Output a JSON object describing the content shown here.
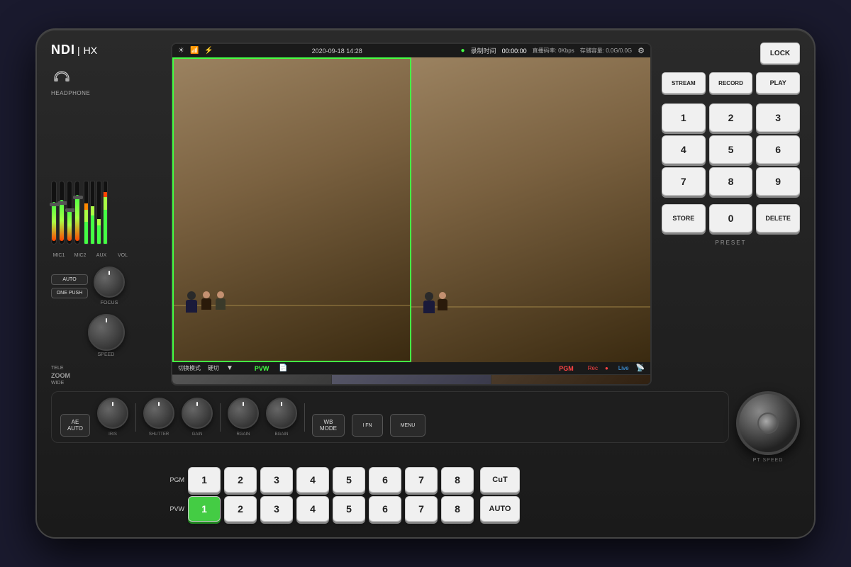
{
  "device": {
    "brand": "NDI",
    "model": "HX",
    "logo": "NDI|HX"
  },
  "left_panel": {
    "headphone_label": "HEADPHONE",
    "fader_labels": [
      "MIC1",
      "MIC2",
      "AUX",
      "VOL"
    ],
    "auto_btn": "AUTO",
    "one_push_btn": "ONE PUSH",
    "focus_label": "FOCUS",
    "speed_label": "SPEED",
    "tele_label": "TELE",
    "zoom_label": "ZOOM",
    "wide_label": "WIDE"
  },
  "screen": {
    "datetime": "2020-09-18 14:28",
    "status_label": "录制时间",
    "record_time": "00:00:00",
    "bitrate_label": "直播码率: 0Kbps",
    "storage_label": "存储容量: 0.0G/0.0G",
    "switch_mode": "切换模式",
    "cut_mode": "硬切",
    "pvw_label": "PVW",
    "pgm_label": "PGM",
    "rec_label": "Rec",
    "live_label": "Live"
  },
  "knobs_row": {
    "ae_auto_label": "AE AUTO",
    "iris_label": "IRIS",
    "shutter_label": "SHUTTER",
    "gain_label": "GAIN",
    "rgain_label": "RGAIN",
    "bgain_label": "BGAIN",
    "wb_mode_label": "WB MODE",
    "fn_label": "I FN",
    "menu_label": "MENU"
  },
  "pgm_row": {
    "label": "PGM",
    "buttons": [
      "1",
      "2",
      "3",
      "4",
      "5",
      "6",
      "7",
      "8"
    ]
  },
  "pvw_row": {
    "label": "PVW",
    "buttons": [
      "1",
      "2",
      "3",
      "4",
      "5",
      "6",
      "7",
      "8"
    ]
  },
  "cut_btn": "CuT",
  "auto_btn": "AUTO",
  "right_panel": {
    "lock_btn": "LOCK",
    "stream_btn": "STREAM",
    "record_btn": "RECORD",
    "play_btn": "PLAY",
    "numpad": [
      "1",
      "2",
      "3",
      "4",
      "5",
      "6",
      "7",
      "8",
      "9"
    ],
    "store_btn": "STORE",
    "zero_btn": "0",
    "delete_btn": "DELETE",
    "preset_label": "PRESET"
  },
  "pt_speed_label": "PT SPEED",
  "colors": {
    "active_green": "#44ff44",
    "active_red": "#ff4444",
    "button_bg": "#f0f0f0",
    "device_bg": "#222",
    "screen_border": "#44ff44"
  }
}
